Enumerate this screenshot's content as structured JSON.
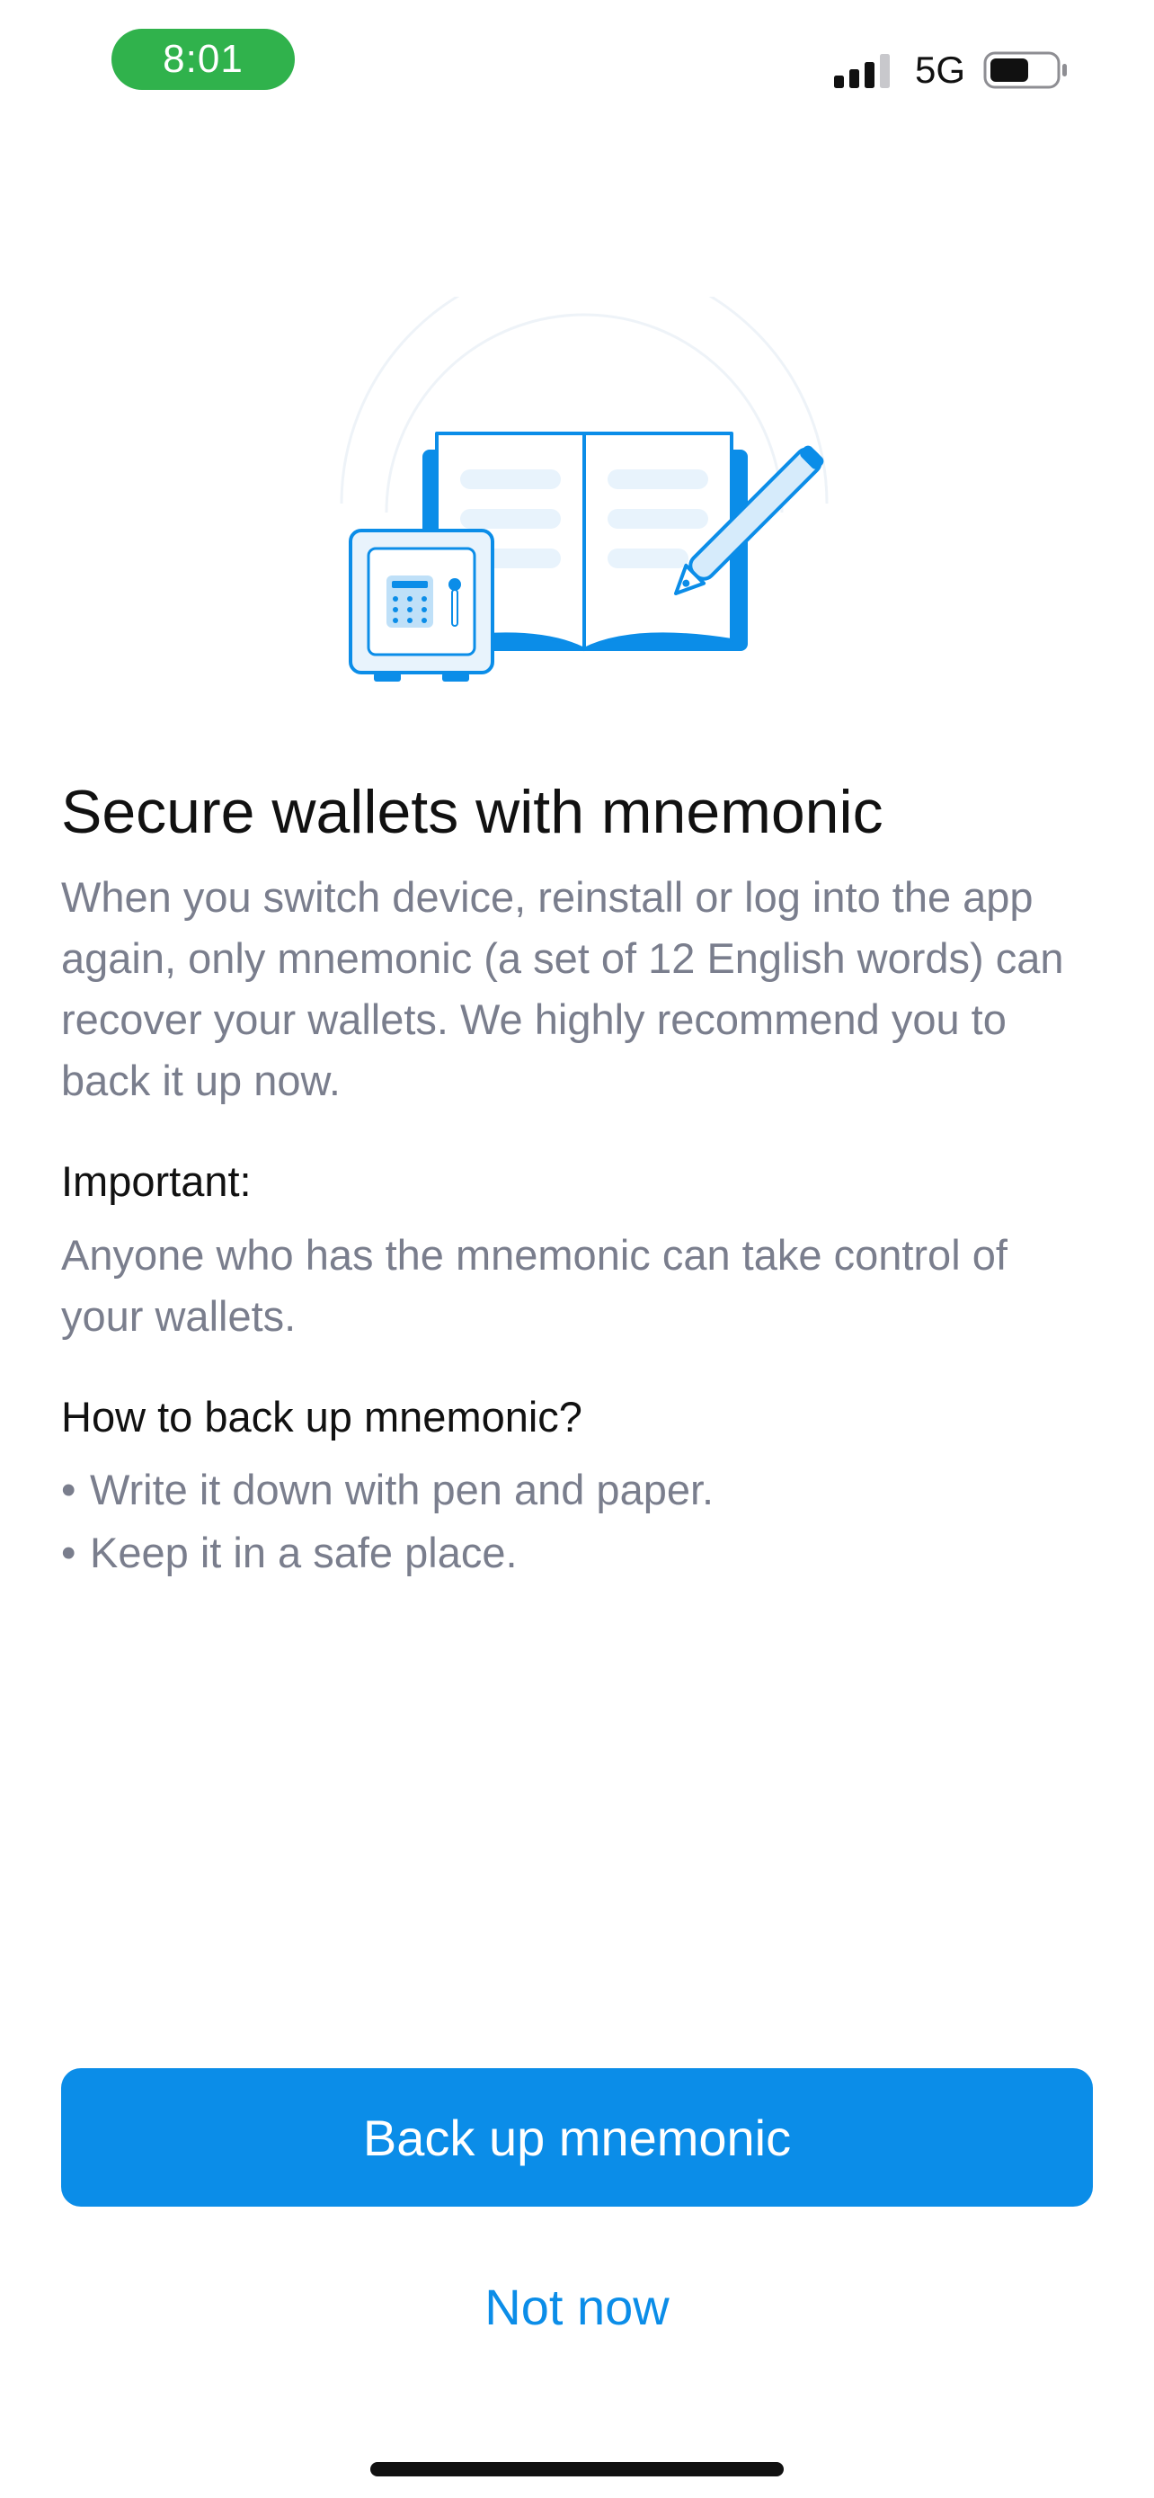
{
  "status_bar": {
    "time": "8:01",
    "network": "5G",
    "time_pill_color": "#30b24c",
    "signal_icon": "cellular-signal-icon",
    "battery_icon": "battery-icon"
  },
  "illustration": {
    "icon": "book-safe-pen-illustration",
    "accent_color": "#0b8de8"
  },
  "content": {
    "title": "Secure wallets with mnemonic",
    "description": "When you switch device, reinstall or log into the app again, only mnemonic (a set of 12 English words) can recover your wallets. We highly recommend you to back it up now.",
    "important_heading": "Important:",
    "important_body": "Anyone who has the mnemonic can take control of your wallets.",
    "howto_heading": "How to back up mnemonic?",
    "howto_items": [
      "Write it down with pen and paper.",
      "Keep it in a safe place."
    ],
    "bullet_char": "•"
  },
  "actions": {
    "primary_label": "Back up mnemonic",
    "secondary_label": "Not now",
    "primary_color": "#0b8de8"
  }
}
